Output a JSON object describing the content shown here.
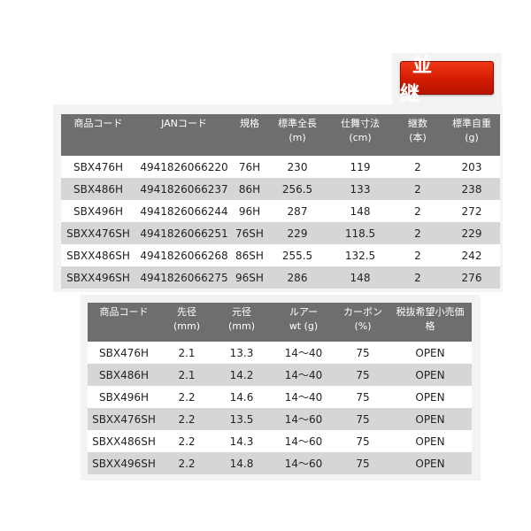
{
  "badge": {
    "label": "並 継"
  },
  "table1": {
    "headers": [
      [
        "商品コード"
      ],
      [
        "JANコード"
      ],
      [
        "規格"
      ],
      [
        "標準全長",
        "(m)"
      ],
      [
        "仕舞寸法",
        "(cm)"
      ],
      [
        "継数",
        "(本)"
      ],
      [
        "標準自重",
        "(g)"
      ]
    ],
    "rows": [
      [
        "SBX476H",
        "4941826066220",
        "76H",
        "230",
        "119",
        "2",
        "203"
      ],
      [
        "SBX486H",
        "4941826066237",
        "86H",
        "256.5",
        "133",
        "2",
        "238"
      ],
      [
        "SBX496H",
        "4941826066244",
        "96H",
        "287",
        "148",
        "2",
        "272"
      ],
      [
        "SBXX476SH",
        "4941826066251",
        "76SH",
        "229",
        "118.5",
        "2",
        "229"
      ],
      [
        "SBXX486SH",
        "4941826066268",
        "86SH",
        "255.5",
        "132.5",
        "2",
        "242"
      ],
      [
        "SBXX496SH",
        "4941826066275",
        "96SH",
        "286",
        "148",
        "2",
        "276"
      ]
    ]
  },
  "table2": {
    "headers": [
      [
        "商品コード"
      ],
      [
        "先径",
        "(mm)"
      ],
      [
        "元径",
        "(mm)"
      ],
      [
        "ルアー",
        "wt (g)"
      ],
      [
        "カーボン",
        "(%)"
      ],
      [
        "税抜希望小売価",
        "格"
      ]
    ],
    "rows": [
      [
        "SBX476H",
        "2.1",
        "13.3",
        "14〜40",
        "75",
        "OPEN"
      ],
      [
        "SBX486H",
        "2.1",
        "14.2",
        "14〜40",
        "75",
        "OPEN"
      ],
      [
        "SBX496H",
        "2.2",
        "14.6",
        "14〜40",
        "75",
        "OPEN"
      ],
      [
        "SBXX476SH",
        "2.2",
        "13.5",
        "14〜60",
        "75",
        "OPEN"
      ],
      [
        "SBXX486SH",
        "2.2",
        "14.3",
        "14〜60",
        "75",
        "OPEN"
      ],
      [
        "SBXX496SH",
        "2.2",
        "14.8",
        "14〜60",
        "75",
        "OPEN"
      ]
    ]
  }
}
